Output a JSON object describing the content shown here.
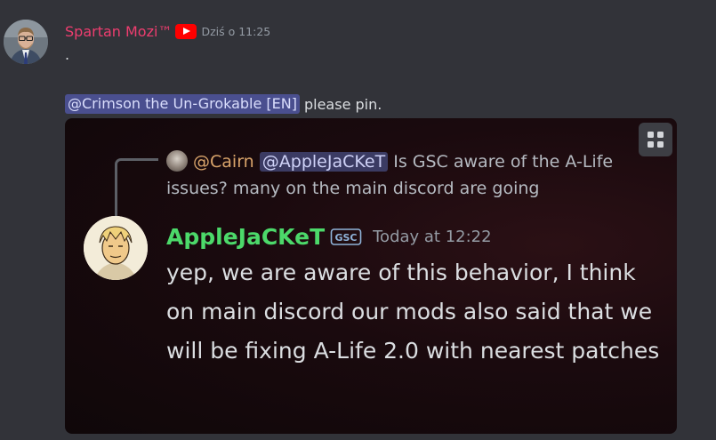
{
  "message": {
    "author": "Spartan Mozi™",
    "author_badge_icon": "youtube-icon",
    "timestamp": "Dziś o 11:25",
    "line1": ".",
    "mention": "@Crimson the Un-Grokable [EN]",
    "after_mention": "please pin."
  },
  "attachment": {
    "expand_icon": "expand-icon",
    "reply": {
      "author": "@Cairn",
      "mention": "@AppleJaCKeT",
      "text": "Is GSC aware of the A-Life issues? many on the main discord are going"
    },
    "inner_message": {
      "author": "AppleJaCKeT",
      "badge_icon": "gsc-icon",
      "timestamp": "Today at 12:22",
      "body": "yep, we are aware of this behavior, I think on main discord our mods also said that we will be fixing A-Life 2.0 with nearest patches"
    }
  },
  "colors": {
    "background": "#323339",
    "username": "#ee3d6f",
    "mention_bg": "#4a4f8f",
    "inner_name": "#4cd96a",
    "reply_author": "#d8a36a"
  }
}
